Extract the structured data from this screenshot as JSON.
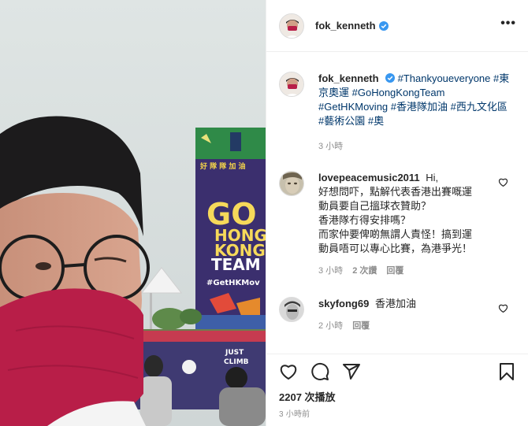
{
  "post": {
    "username": "fok_kenneth",
    "caption_hashtags": [
      "#Thankyoueveryone",
      "#東京奧運",
      "#GoHongKongTeam",
      "#GetHKMoving",
      "#香港隊加油",
      "#西九文化區",
      "#藝術公園",
      "#奧"
    ],
    "caption_time": "3 小時",
    "more_label": "•••"
  },
  "comments": [
    {
      "username": "lovepeacemusic2011",
      "lines": [
        "Hi,",
        "好想問吓，點解代表香港出賽嘅運",
        "動員要自己搵球衣贊助？",
        "香港隊冇得安排嗎？",
        "而家仲要俾啲無謂人責怪！搞到運",
        "動員唔可以專心比賽，為港爭光！"
      ],
      "time": "3 小時",
      "likes": "2 次讚",
      "reply": "回覆"
    },
    {
      "username": "skyfong69",
      "text": "香港加油",
      "time": "2 小時",
      "reply": "回覆"
    }
  ],
  "actions": {
    "views": "2207 次播放",
    "timestamp": "3 小時前"
  },
  "media": {
    "banner_title_lines": [
      "GO",
      "HONG",
      "KONG",
      "TEAM"
    ],
    "banner_hashtag": "#GetHKMov",
    "banner_top_text": "好 隊 隊 加 油",
    "booth_lines": [
      "JUST",
      "CLIMB"
    ]
  },
  "colors": {
    "link": "#00376b",
    "muted": "#8e8e8e",
    "verified": "#3897f0",
    "mask": "#b81e48",
    "banner": "#3b2f6e"
  },
  "icons": [
    "verified-icon",
    "more-icon",
    "heart-icon",
    "comment-icon",
    "share-icon",
    "bookmark-icon"
  ]
}
